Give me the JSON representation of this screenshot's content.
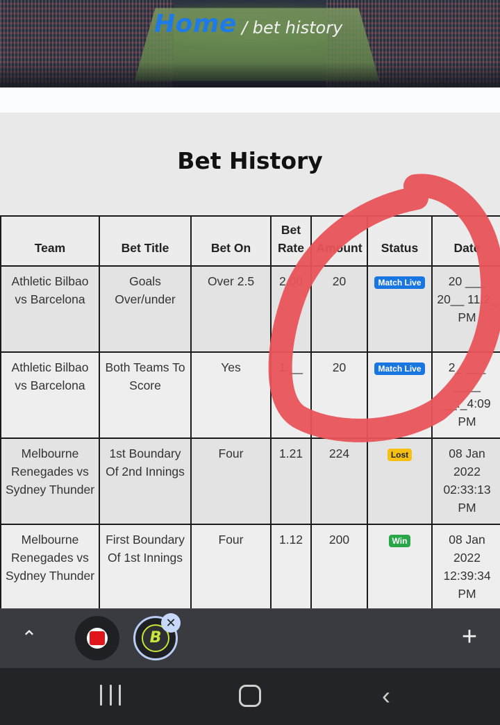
{
  "header": {
    "home_link": "Home",
    "crumb": "/ bet history"
  },
  "page_title": "Bet History",
  "table": {
    "columns": [
      "Team",
      "Bet Title",
      "Bet On",
      "Bet Rate",
      "Amount",
      "Status",
      "Date"
    ],
    "rows": [
      {
        "team": "Athletic Bilbao vs Barcelona",
        "title": "Goals Over/under",
        "bet_on": "Over 2.5",
        "rate": "2.00",
        "amount": "20",
        "status": "Match Live",
        "date": "20 ___ 20__ 11:2_ PM"
      },
      {
        "team": "Athletic Bilbao vs Barcelona",
        "title": "Both Teams To Score",
        "bet_on": "Yes",
        "rate": "1.__",
        "amount": "20",
        "status": "Match Live",
        "date": "2_ ___ ____ __:_4:09 PM"
      },
      {
        "team": "Melbourne Renegades vs Sydney Thunder",
        "title": "1st Boundary Of 2nd Innings",
        "bet_on": "Four",
        "rate": "1.21",
        "amount": "224",
        "status": "Lost",
        "date": "08 Jan 2022 02:33:13 PM"
      },
      {
        "team": "Melbourne Renegades vs Sydney Thunder",
        "title": "First Boundary Of 1st Innings",
        "bet_on": "Four",
        "rate": "1.12",
        "amount": "200",
        "status": "Win",
        "date": "08 Jan 2022 12:39:34 PM"
      }
    ]
  },
  "colors": {
    "home_link": "#1e7be6",
    "status_live": "#1976e0",
    "status_lost": "#f5c013",
    "status_win": "#27a745",
    "scribble": "#e8545a"
  },
  "browser_bar": {
    "icons": [
      "chevron-up-icon",
      "red-tab-icon",
      "bet-site-tab-icon",
      "close-icon",
      "plus-icon"
    ],
    "bet_logo_letter": "B"
  },
  "nav_bar": {
    "icons": [
      "recent-apps-icon",
      "home-icon",
      "back-icon"
    ]
  }
}
